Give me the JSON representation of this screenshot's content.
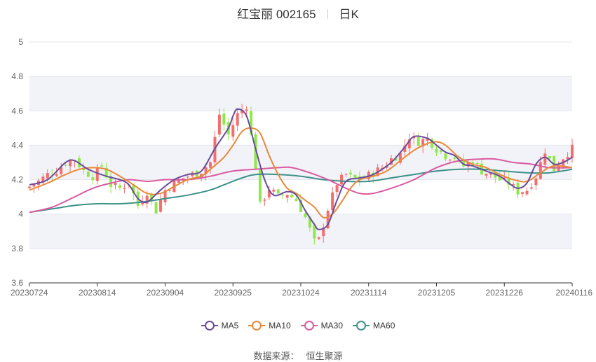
{
  "header": {
    "title": "红宝丽 002165",
    "period": "日K"
  },
  "source": {
    "label": "数据来源：",
    "name": "恒生聚源"
  },
  "colors": {
    "up": "#f46e6e",
    "down": "#8fe84a",
    "band": "#f2f3f8",
    "grid": "#e3e5ee",
    "axis": "#333333",
    "tick": "#666666"
  },
  "chart_data": {
    "type": "candlestick",
    "ylim": [
      3.6,
      5.0
    ],
    "yticks": [
      "3.6",
      "3.8",
      "4",
      "4.2",
      "4.4",
      "4.6",
      "4.8",
      "5"
    ],
    "xticks": [
      "20230724",
      "20230814",
      "20230904",
      "20230925",
      "20231024",
      "20231114",
      "20231205",
      "20231226",
      "20240116"
    ],
    "xtick_index": [
      0,
      15,
      30,
      45,
      60,
      75,
      90,
      105,
      120
    ],
    "n": 121,
    "close_points": [
      [
        0,
        4.16
      ],
      [
        2,
        4.19
      ],
      [
        4,
        4.23
      ],
      [
        6,
        4.25
      ],
      [
        8,
        4.3
      ],
      [
        10,
        4.32
      ],
      [
        12,
        4.25
      ],
      [
        14,
        4.22
      ],
      [
        16,
        4.28
      ],
      [
        18,
        4.17
      ],
      [
        20,
        4.15
      ],
      [
        22,
        4.18
      ],
      [
        24,
        4.05
      ],
      [
        26,
        4.13
      ],
      [
        28,
        4.02
      ],
      [
        30,
        4.14
      ],
      [
        32,
        4.18
      ],
      [
        34,
        4.21
      ],
      [
        36,
        4.23
      ],
      [
        38,
        4.25
      ],
      [
        40,
        4.3
      ],
      [
        42,
        4.58
      ],
      [
        44,
        4.46
      ],
      [
        46,
        4.58
      ],
      [
        48,
        4.63
      ],
      [
        50,
        4.28
      ],
      [
        51,
        4.05
      ],
      [
        53,
        4.15
      ],
      [
        55,
        4.1
      ],
      [
        57,
        4.12
      ],
      [
        59,
        4.08
      ],
      [
        61,
        3.98
      ],
      [
        63,
        3.84
      ],
      [
        64,
        3.85
      ],
      [
        66,
        4.03
      ],
      [
        68,
        4.18
      ],
      [
        70,
        4.23
      ],
      [
        72,
        4.2
      ],
      [
        74,
        4.21
      ],
      [
        76,
        4.24
      ],
      [
        78,
        4.27
      ],
      [
        80,
        4.32
      ],
      [
        82,
        4.35
      ],
      [
        84,
        4.45
      ],
      [
        86,
        4.42
      ],
      [
        88,
        4.44
      ],
      [
        90,
        4.38
      ],
      [
        92,
        4.34
      ],
      [
        94,
        4.33
      ],
      [
        96,
        4.28
      ],
      [
        98,
        4.31
      ],
      [
        100,
        4.25
      ],
      [
        102,
        4.23
      ],
      [
        104,
        4.2
      ],
      [
        106,
        4.18
      ],
      [
        108,
        4.13
      ],
      [
        110,
        4.14
      ],
      [
        112,
        4.22
      ],
      [
        114,
        4.37
      ],
      [
        116,
        4.26
      ],
      [
        118,
        4.33
      ],
      [
        120,
        4.38
      ]
    ],
    "series": [
      {
        "name": "MA5",
        "color": "#6a4c9c",
        "points": [
          [
            0,
            4.17
          ],
          [
            4,
            4.2
          ],
          [
            8,
            4.3
          ],
          [
            10,
            4.31
          ],
          [
            13,
            4.26
          ],
          [
            17,
            4.22
          ],
          [
            20,
            4.2
          ],
          [
            22,
            4.17
          ],
          [
            24,
            4.09
          ],
          [
            26,
            4.07
          ],
          [
            29,
            4.14
          ],
          [
            32,
            4.2
          ],
          [
            35,
            4.23
          ],
          [
            38,
            4.25
          ],
          [
            41,
            4.38
          ],
          [
            44,
            4.5
          ],
          [
            45,
            4.57
          ],
          [
            46,
            4.61
          ],
          [
            48,
            4.57
          ],
          [
            50,
            4.38
          ],
          [
            52,
            4.2
          ],
          [
            54,
            4.11
          ],
          [
            57,
            4.13
          ],
          [
            59,
            4.11
          ],
          [
            61,
            4.02
          ],
          [
            63,
            3.94
          ],
          [
            64,
            3.91
          ],
          [
            66,
            3.94
          ],
          [
            68,
            4.08
          ],
          [
            70,
            4.19
          ],
          [
            73,
            4.21
          ],
          [
            76,
            4.23
          ],
          [
            80,
            4.3
          ],
          [
            83,
            4.39
          ],
          [
            85,
            4.45
          ],
          [
            88,
            4.44
          ],
          [
            90,
            4.4
          ],
          [
            92,
            4.36
          ],
          [
            94,
            4.34
          ],
          [
            96,
            4.29
          ],
          [
            98,
            4.28
          ],
          [
            101,
            4.25
          ],
          [
            104,
            4.22
          ],
          [
            106,
            4.18
          ],
          [
            108,
            4.15
          ],
          [
            110,
            4.18
          ],
          [
            112,
            4.29
          ],
          [
            114,
            4.33
          ],
          [
            116,
            4.29
          ],
          [
            118,
            4.3
          ],
          [
            120,
            4.33
          ]
        ]
      },
      {
        "name": "MA10",
        "color": "#e8893a",
        "points": [
          [
            0,
            4.14
          ],
          [
            4,
            4.18
          ],
          [
            8,
            4.23
          ],
          [
            11,
            4.26
          ],
          [
            14,
            4.27
          ],
          [
            17,
            4.26
          ],
          [
            20,
            4.22
          ],
          [
            23,
            4.17
          ],
          [
            26,
            4.12
          ],
          [
            29,
            4.12
          ],
          [
            32,
            4.16
          ],
          [
            35,
            4.2
          ],
          [
            38,
            4.22
          ],
          [
            40,
            4.26
          ],
          [
            43,
            4.33
          ],
          [
            45,
            4.4
          ],
          [
            47,
            4.48
          ],
          [
            49,
            4.5
          ],
          [
            51,
            4.47
          ],
          [
            53,
            4.34
          ],
          [
            55,
            4.23
          ],
          [
            57,
            4.15
          ],
          [
            59,
            4.12
          ],
          [
            61,
            4.08
          ],
          [
            63,
            4.04
          ],
          [
            65,
            3.98
          ],
          [
            67,
            4.0
          ],
          [
            69,
            4.07
          ],
          [
            71,
            4.15
          ],
          [
            73,
            4.2
          ],
          [
            76,
            4.22
          ],
          [
            79,
            4.25
          ],
          [
            82,
            4.31
          ],
          [
            85,
            4.37
          ],
          [
            88,
            4.41
          ],
          [
            90,
            4.42
          ],
          [
            92,
            4.4
          ],
          [
            95,
            4.33
          ],
          [
            98,
            4.29
          ],
          [
            101,
            4.27
          ],
          [
            104,
            4.23
          ],
          [
            107,
            4.2
          ],
          [
            110,
            4.19
          ],
          [
            113,
            4.24
          ],
          [
            116,
            4.28
          ],
          [
            120,
            4.27
          ]
        ]
      },
      {
        "name": "MA30",
        "color": "#d95a9f",
        "points": [
          [
            0,
            4.01
          ],
          [
            5,
            4.04
          ],
          [
            10,
            4.1
          ],
          [
            14,
            4.15
          ],
          [
            18,
            4.18
          ],
          [
            22,
            4.2
          ],
          [
            26,
            4.19
          ],
          [
            30,
            4.2
          ],
          [
            35,
            4.2
          ],
          [
            40,
            4.22
          ],
          [
            45,
            4.25
          ],
          [
            50,
            4.26
          ],
          [
            55,
            4.27
          ],
          [
            58,
            4.27
          ],
          [
            62,
            4.24
          ],
          [
            66,
            4.2
          ],
          [
            70,
            4.15
          ],
          [
            73,
            4.12
          ],
          [
            76,
            4.12
          ],
          [
            80,
            4.15
          ],
          [
            85,
            4.2
          ],
          [
            90,
            4.27
          ],
          [
            95,
            4.31
          ],
          [
            100,
            4.32
          ],
          [
            103,
            4.32
          ],
          [
            107,
            4.3
          ],
          [
            111,
            4.29
          ],
          [
            115,
            4.27
          ],
          [
            120,
            4.27
          ]
        ]
      },
      {
        "name": "MA60",
        "color": "#3e918a",
        "points": [
          [
            0,
            4.01
          ],
          [
            5,
            4.03
          ],
          [
            10,
            4.05
          ],
          [
            15,
            4.06
          ],
          [
            20,
            4.06
          ],
          [
            25,
            4.07
          ],
          [
            30,
            4.09
          ],
          [
            35,
            4.11
          ],
          [
            40,
            4.14
          ],
          [
            43,
            4.17
          ],
          [
            47,
            4.21
          ],
          [
            50,
            4.23
          ],
          [
            55,
            4.23
          ],
          [
            60,
            4.22
          ],
          [
            65,
            4.2
          ],
          [
            70,
            4.19
          ],
          [
            75,
            4.19
          ],
          [
            80,
            4.21
          ],
          [
            85,
            4.23
          ],
          [
            90,
            4.25
          ],
          [
            95,
            4.26
          ],
          [
            100,
            4.26
          ],
          [
            105,
            4.25
          ],
          [
            110,
            4.24
          ],
          [
            115,
            4.24
          ],
          [
            120,
            4.26
          ]
        ]
      }
    ]
  }
}
